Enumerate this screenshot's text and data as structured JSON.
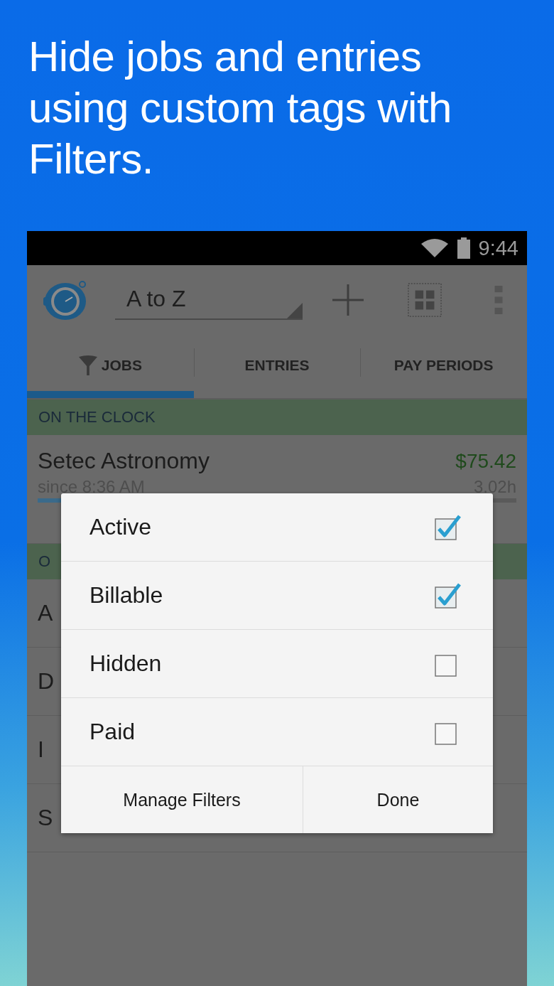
{
  "headline": "Hide jobs and entries using custom tags with Filters.",
  "status_bar": {
    "time": "9:44"
  },
  "toolbar": {
    "sort": "A to Z"
  },
  "tabs": [
    {
      "label": "JOBS",
      "selected": true,
      "filtered": true
    },
    {
      "label": "ENTRIES",
      "selected": false,
      "filtered": false
    },
    {
      "label": "PAY PERIODS",
      "selected": false,
      "filtered": false
    }
  ],
  "sections": [
    {
      "header": "ON THE CLOCK",
      "jobs": [
        {
          "name": "Setec Astronomy",
          "amount": "$75.42",
          "since": "since 8:36 AM",
          "hours": "3.02h",
          "level": 0.05
        }
      ]
    },
    {
      "header": "O",
      "jobs": [
        {
          "name": "A"
        },
        {
          "name": "D"
        },
        {
          "name": "I"
        },
        {
          "name": "S"
        }
      ]
    }
  ],
  "dialog": {
    "options": [
      {
        "label": "Active",
        "checked": true
      },
      {
        "label": "Billable",
        "checked": true
      },
      {
        "label": "Hidden",
        "checked": false
      },
      {
        "label": "Paid",
        "checked": false
      }
    ],
    "buttons": [
      "Manage Filters",
      "Done"
    ]
  }
}
